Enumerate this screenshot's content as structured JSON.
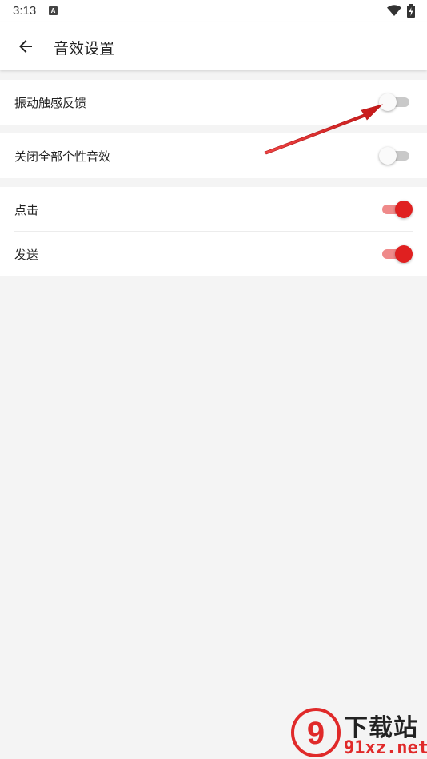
{
  "status_bar": {
    "time": "3:13",
    "notification_icon": "a-letter-icon",
    "wifi_icon": "wifi-icon",
    "battery_icon": "battery-charging-icon"
  },
  "app_bar": {
    "back_icon": "back-arrow-icon",
    "title": "音效设置"
  },
  "sections": [
    {
      "rows": [
        {
          "label": "振动触感反馈",
          "enabled": false
        }
      ]
    },
    {
      "rows": [
        {
          "label": "关闭全部个性音效",
          "enabled": false
        }
      ]
    },
    {
      "rows": [
        {
          "label": "点击",
          "enabled": true
        },
        {
          "label": "发送",
          "enabled": true
        }
      ]
    }
  ],
  "colors": {
    "accent": "#e02020",
    "accent_track": "#ef8a8a",
    "background": "#f4f4f4",
    "annotation_arrow": "#d42020"
  },
  "watermark": {
    "title": "下载站",
    "domain": "91xz.net",
    "logo_text": "9"
  }
}
